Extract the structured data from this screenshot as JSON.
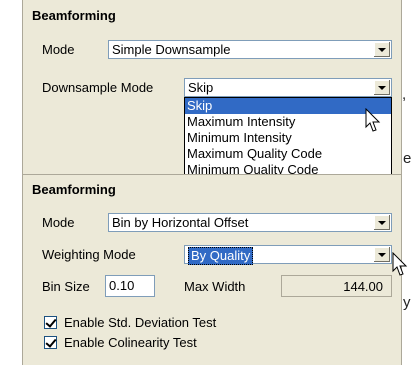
{
  "background_fragments": [
    ",",
    "e",
    "y"
  ],
  "top_panel": {
    "title": "Beamforming",
    "mode_label": "Mode",
    "mode_value": "Simple Downsample",
    "downsample_label": "Downsample Mode",
    "downsample_value": "Skip",
    "dropdown_options": [
      "Skip",
      "Maximum Intensity",
      "Minimum Intensity",
      "Maximum Quality Code",
      "Minimum Quality Code"
    ],
    "selected_option": "Skip"
  },
  "bottom_panel": {
    "title": "Beamforming",
    "mode_label": "Mode",
    "mode_value": "Bin by Horizontal Offset",
    "weighting_label": "Weighting Mode",
    "weighting_value": "By Quality",
    "bin_size_label": "Bin Size",
    "bin_size_value": "0.10",
    "max_width_label": "Max Width",
    "max_width_value": "144.00",
    "check1_label": "Enable Std. Deviation Test",
    "check1_checked": true,
    "check2_label": "Enable Colinearity Test",
    "check2_checked": true
  },
  "colors": {
    "panel_bg": "#ece9d8",
    "highlight": "#316ac5"
  }
}
